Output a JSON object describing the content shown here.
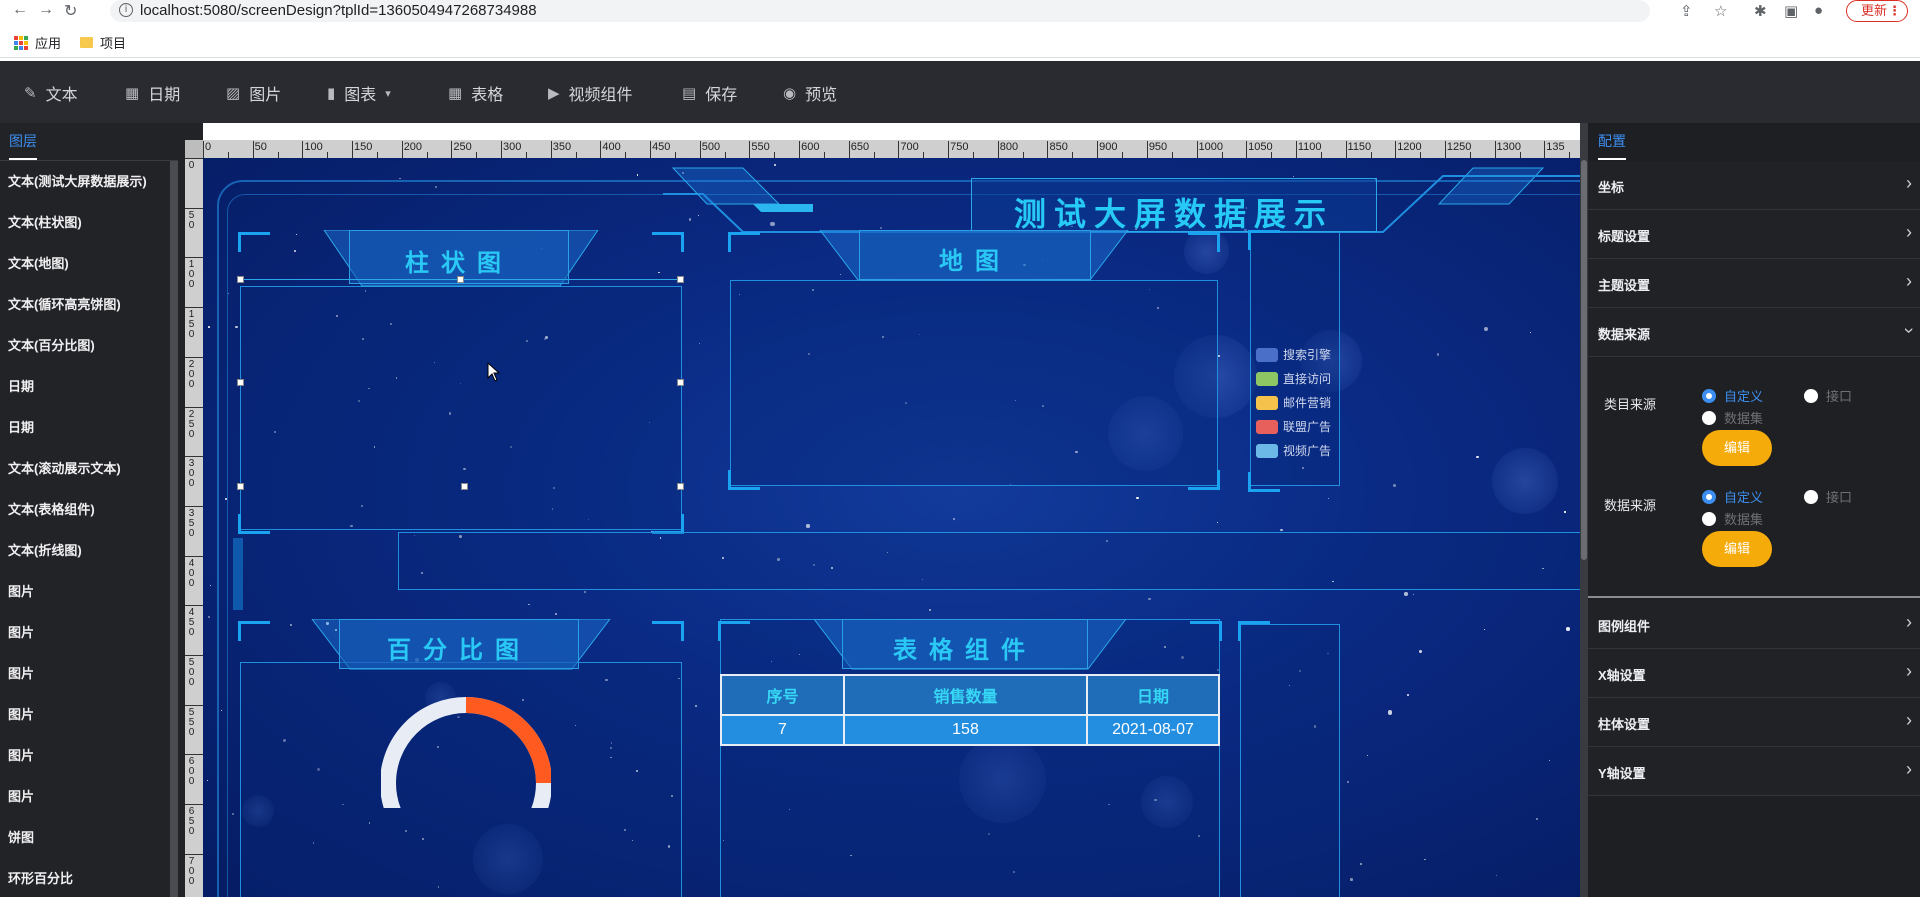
{
  "browser": {
    "url": "localhost:5080/screenDesign?tplId=1360504947268734988",
    "update_label": "更新",
    "bookmarks": [
      "应用",
      "项目"
    ]
  },
  "toolbar": {
    "items": [
      {
        "label": "文本",
        "icon": "edit-icon"
      },
      {
        "label": "日期",
        "icon": "calendar-icon"
      },
      {
        "label": "图片",
        "icon": "image-icon"
      },
      {
        "label": "图表",
        "icon": "bar-chart-icon"
      },
      {
        "label": "表格",
        "icon": "table-icon"
      },
      {
        "label": "视频组件",
        "icon": "video-icon"
      },
      {
        "label": "保存",
        "icon": "save-icon"
      },
      {
        "label": "预览",
        "icon": "eye-icon"
      }
    ]
  },
  "layers": {
    "tab": "图层",
    "items": [
      "文本(测试大屏数据展示)",
      "文本(柱状图)",
      "文本(地图)",
      "文本(循环高亮饼图)",
      "文本(百分比图)",
      "日期",
      "日期",
      "文本(滚动展示文本)",
      "文本(表格组件)",
      "文本(折线图)",
      "图片",
      "图片",
      "图片",
      "图片",
      "图片",
      "图片",
      "饼图",
      "环形百分比"
    ]
  },
  "ruler": {
    "top_labels": [
      "0",
      "50",
      "100",
      "150",
      "200",
      "250",
      "300",
      "350",
      "400",
      "450",
      "500",
      "550",
      "600",
      "650",
      "700",
      "750",
      "800",
      "850",
      "900",
      "950",
      "1000",
      "1050",
      "1100",
      "1150",
      "1200",
      "1250",
      "1300",
      "135"
    ],
    "left_labels": [
      "0",
      "50",
      "100",
      "150",
      "200",
      "250",
      "300",
      "350",
      "400",
      "450",
      "500",
      "550",
      "600",
      "650",
      "700"
    ]
  },
  "canvas": {
    "title": "测试大屏数据展示",
    "panels": {
      "bar": "柱状图",
      "map": "地图",
      "percent": "百分比图",
      "table": "表格组件"
    },
    "legend": [
      {
        "label": "搜索引擎",
        "color": "#4a6fc9"
      },
      {
        "label": "直接访问",
        "color": "#8fc664"
      },
      {
        "label": "邮件营销",
        "color": "#f5c24c"
      },
      {
        "label": "联盟广告",
        "color": "#e8605c"
      },
      {
        "label": "视频广告",
        "color": "#6cb8e6"
      }
    ],
    "table": {
      "headers": [
        "序号",
        "销售数量",
        "日期"
      ],
      "rows": [
        [
          "7",
          "158",
          "2021-08-07"
        ]
      ]
    },
    "donut": {
      "value_fraction": 0.25,
      "track_color": "#e8ecf5",
      "value_color": "#ff5a1f"
    }
  },
  "config": {
    "tab": "配置",
    "sections_top": [
      "坐标",
      "标题设置",
      "主题设置"
    ],
    "open_section": "数据来源",
    "category_source": {
      "label": "类目来源",
      "options": [
        "自定义",
        "接口",
        "数据集"
      ],
      "selected": "自定义",
      "button": "编辑"
    },
    "data_source": {
      "label": "数据来源",
      "options": [
        "自定义",
        "接口",
        "数据集"
      ],
      "selected": "自定义",
      "button": "编辑"
    },
    "sections_bottom": [
      "图例组件",
      "X轴设置",
      "柱体设置",
      "Y轴设置"
    ]
  },
  "colors": {
    "accent": "#3c8ff0",
    "button": "#f5ab0a",
    "title_cyan": "#27c9f5"
  }
}
